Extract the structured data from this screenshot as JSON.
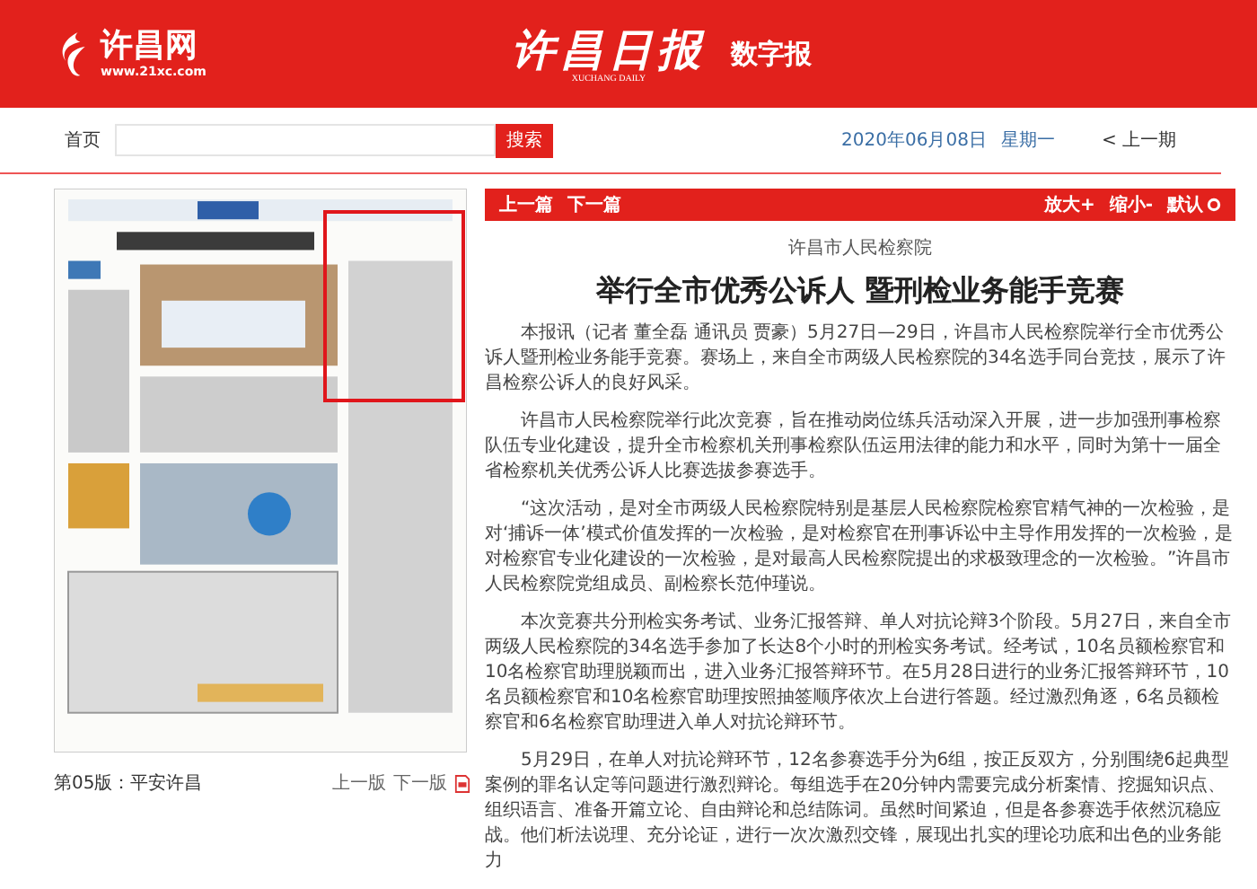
{
  "header": {
    "site_name": "许昌网",
    "site_url": "www.21xc.com",
    "paper_title": "许昌日报",
    "paper_subtitle": "XUCHANG DAILY",
    "digital_label": "数字报"
  },
  "nav": {
    "home": "首页",
    "search_button": "搜索",
    "date": "2020年06月08日",
    "weekday": "星期一",
    "prev_issue": "< 上一期"
  },
  "page_view": {
    "kind": "picture",
    "edition": "第05版：平安许昌",
    "prev_page": "上一版",
    "next_page": "下一版"
  },
  "article_toolbar": {
    "prev": "上一篇",
    "next": "下一篇",
    "zoom_in": "放大+",
    "zoom_out": "缩小-",
    "reset": "默认"
  },
  "article": {
    "source": "许昌市人民检察院",
    "title": "举行全市优秀公诉人 暨刑检业务能手竞赛",
    "paragraphs": [
      "本报讯（记者 董全磊 通讯员 贾豪）5月27日—29日，许昌市人民检察院举行全市优秀公诉人暨刑检业务能手竞赛。赛场上，来自全市两级人民检察院的34名选手同台竞技，展示了许昌检察公诉人的良好风采。",
      "许昌市人民检察院举行此次竞赛，旨在推动岗位练兵活动深入开展，进一步加强刑事检察队伍专业化建设，提升全市检察机关刑事检察队伍运用法律的能力和水平，同时为第十一届全省检察机关优秀公诉人比赛选拔参赛选手。",
      "“这次活动，是对全市两级人民检察院特别是基层人民检察院检察官精气神的一次检验，是对‘捕诉一体’模式价值发挥的一次检验，是对检察官在刑事诉讼中主导作用发挥的一次检验，是对检察官专业化建设的一次检验，是对最高人民检察院提出的求极致理念的一次检验。”许昌市人民检察院党组成员、副检察长范仲瑾说。",
      "本次竞赛共分刑检实务考试、业务汇报答辩、单人对抗论辩3个阶段。5月27日，来自全市两级人民检察院的34名选手参加了长达8个小时的刑检实务考试。经考试，10名员额检察官和10名检察官助理脱颖而出，进入业务汇报答辩环节。在5月28日进行的业务汇报答辩环节，10名员额检察官和10名检察官助理按照抽签顺序依次上台进行答题。经过激烈角逐，6名员额检察官和6名检察官助理进入单人对抗论辩环节。",
      "5月29日，在单人对抗论辩环节，12名参赛选手分为6组，按正反双方，分别围绕6起典型案例的罪名认定等问题进行激烈辩论。每组选手在20分钟内需要完成分析案情、挖掘知识点、组织语言、准备开篇立论、自由辩论和总结陈词。虽然时间紧迫，但是各参赛选手依然沉稳应战。他们析法说理、充分论证，进行一次次激烈交锋，展现出扎实的理论功底和出色的业务能力"
    ]
  }
}
